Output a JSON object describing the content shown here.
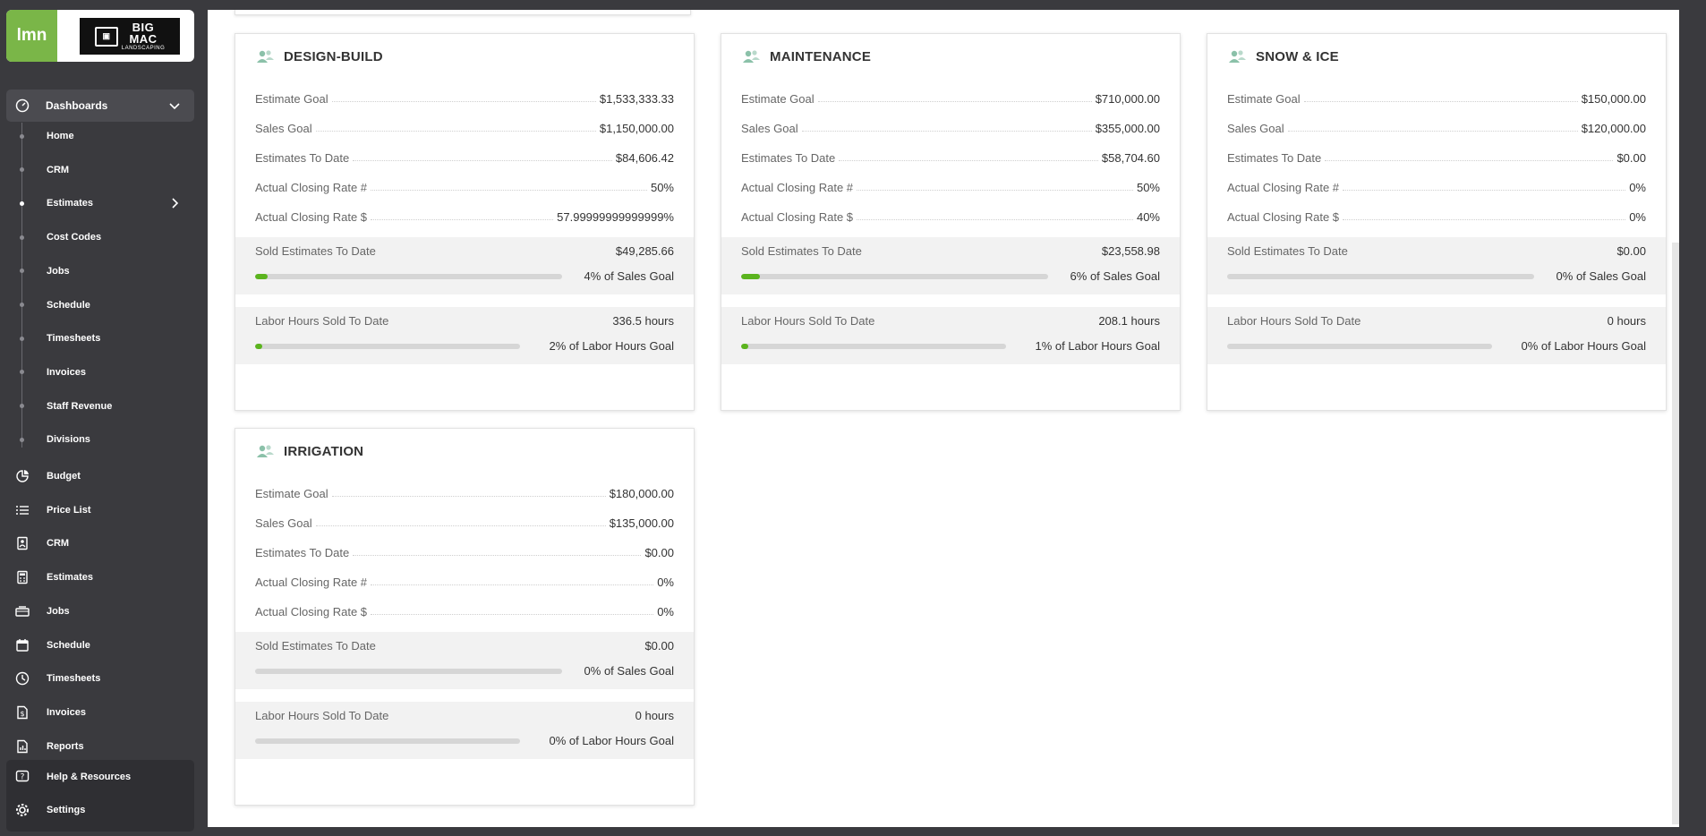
{
  "brand": {
    "app_logo": "lmn",
    "client_logo_line1": "BIG",
    "client_logo_line2": "MAC",
    "client_logo_line3": "LANDSCAPING"
  },
  "sidebar": {
    "dashboards_label": "Dashboards",
    "sub_items": [
      {
        "label": "Home"
      },
      {
        "label": "CRM"
      },
      {
        "label": "Estimates",
        "active": true
      },
      {
        "label": "Cost Codes"
      },
      {
        "label": "Jobs"
      },
      {
        "label": "Schedule"
      },
      {
        "label": "Timesheets"
      },
      {
        "label": "Invoices"
      },
      {
        "label": "Staff Revenue"
      },
      {
        "label": "Divisions"
      }
    ],
    "main_items": [
      {
        "label": "Budget",
        "icon": "pie-chart-icon"
      },
      {
        "label": "Price List",
        "icon": "list-icon"
      },
      {
        "label": "CRM",
        "icon": "contact-card-icon"
      },
      {
        "label": "Estimates",
        "icon": "calculator-icon"
      },
      {
        "label": "Jobs",
        "icon": "truck-icon"
      },
      {
        "label": "Schedule",
        "icon": "calendar-icon"
      },
      {
        "label": "Timesheets",
        "icon": "clock-icon"
      },
      {
        "label": "Invoices",
        "icon": "invoice-icon"
      },
      {
        "label": "Reports",
        "icon": "report-icon"
      }
    ],
    "bottom_items": [
      {
        "label": "Help & Resources",
        "icon": "help-icon"
      },
      {
        "label": "Settings",
        "icon": "gear-icon"
      }
    ]
  },
  "colors": {
    "accent_green": "#5bb41e",
    "sidebar_bg": "#3a3a3e",
    "band_bg": "#f2f2f2"
  },
  "cards": [
    {
      "title": "DESIGN-BUILD",
      "rows": [
        {
          "k": "Estimate Goal",
          "v": "$1,533,333.33"
        },
        {
          "k": "Sales Goal",
          "v": "$1,150,000.00"
        },
        {
          "k": "Estimates To Date",
          "v": "$84,606.42"
        },
        {
          "k": "Actual Closing Rate #",
          "v": "50%"
        },
        {
          "k": "Actual Closing Rate $",
          "v": "57.99999999999999%"
        }
      ],
      "sold": {
        "label": "Sold Estimates To Date",
        "value": "$49,285.66",
        "pct_label": "4% of Sales Goal",
        "fraction": 0.04
      },
      "labor": {
        "label": "Labor Hours Sold To Date",
        "value": "336.5 hours",
        "pct_label": "2% of Labor Hours Goal",
        "fraction": 0.02
      }
    },
    {
      "title": "MAINTENANCE",
      "rows": [
        {
          "k": "Estimate Goal",
          "v": "$710,000.00"
        },
        {
          "k": "Sales Goal",
          "v": "$355,000.00"
        },
        {
          "k": "Estimates To Date",
          "v": "$58,704.60"
        },
        {
          "k": "Actual Closing Rate #",
          "v": "50%"
        },
        {
          "k": "Actual Closing Rate $",
          "v": "40%"
        }
      ],
      "sold": {
        "label": "Sold Estimates To Date",
        "value": "$23,558.98",
        "pct_label": "6% of Sales Goal",
        "fraction": 0.06
      },
      "labor": {
        "label": "Labor Hours Sold To Date",
        "value": "208.1 hours",
        "pct_label": "1% of Labor Hours Goal",
        "fraction": 0.01
      }
    },
    {
      "title": "SNOW & ICE",
      "rows": [
        {
          "k": "Estimate Goal",
          "v": "$150,000.00"
        },
        {
          "k": "Sales Goal",
          "v": "$120,000.00"
        },
        {
          "k": "Estimates To Date",
          "v": "$0.00"
        },
        {
          "k": "Actual Closing Rate #",
          "v": "0%"
        },
        {
          "k": "Actual Closing Rate $",
          "v": "0%"
        }
      ],
      "sold": {
        "label": "Sold Estimates To Date",
        "value": "$0.00",
        "pct_label": "0% of Sales Goal",
        "fraction": 0
      },
      "labor": {
        "label": "Labor Hours Sold To Date",
        "value": "0 hours",
        "pct_label": "0% of Labor Hours Goal",
        "fraction": 0
      }
    },
    {
      "title": "IRRIGATION",
      "rows": [
        {
          "k": "Estimate Goal",
          "v": "$180,000.00"
        },
        {
          "k": "Sales Goal",
          "v": "$135,000.00"
        },
        {
          "k": "Estimates To Date",
          "v": "$0.00"
        },
        {
          "k": "Actual Closing Rate #",
          "v": "0%"
        },
        {
          "k": "Actual Closing Rate $",
          "v": "0%"
        }
      ],
      "sold": {
        "label": "Sold Estimates To Date",
        "value": "$0.00",
        "pct_label": "0% of Sales Goal",
        "fraction": 0
      },
      "labor": {
        "label": "Labor Hours Sold To Date",
        "value": "0 hours",
        "pct_label": "0% of Labor Hours Goal",
        "fraction": 0
      }
    }
  ]
}
